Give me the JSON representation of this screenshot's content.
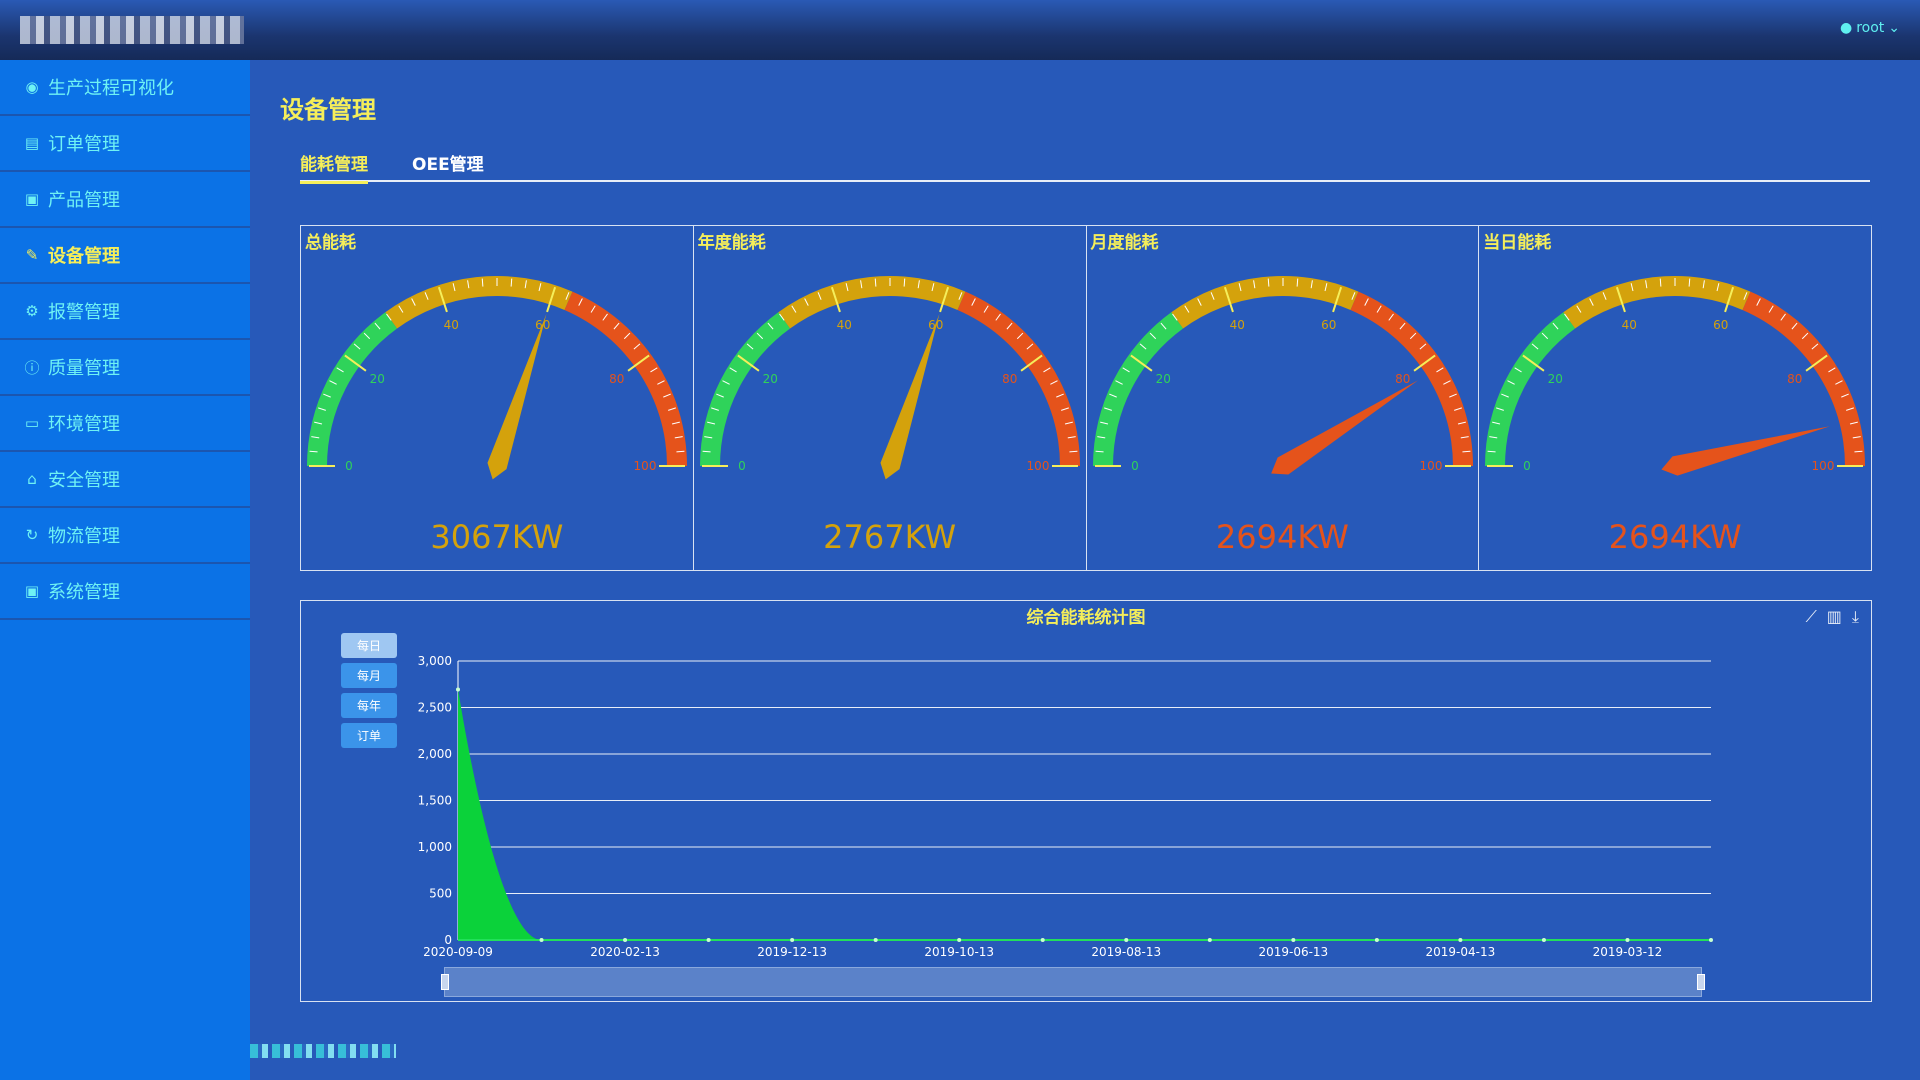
{
  "user": {
    "name": "root"
  },
  "sidebar": {
    "items": [
      {
        "label": "生产过程可视化",
        "icon": "eye-icon",
        "glyph": "◉"
      },
      {
        "label": "订单管理",
        "icon": "document-icon",
        "glyph": "▤"
      },
      {
        "label": "产品管理",
        "icon": "product-icon",
        "glyph": "▣"
      },
      {
        "label": "设备管理",
        "icon": "pen-icon",
        "glyph": "✎"
      },
      {
        "label": "报警管理",
        "icon": "chip-icon",
        "glyph": "⚙"
      },
      {
        "label": "质量管理",
        "icon": "info-icon",
        "glyph": "ⓘ"
      },
      {
        "label": "环境管理",
        "icon": "box-icon",
        "glyph": "▭"
      },
      {
        "label": "安全管理",
        "icon": "shield-icon",
        "glyph": "⌂"
      },
      {
        "label": "物流管理",
        "icon": "refresh-icon",
        "glyph": "↻"
      },
      {
        "label": "系统管理",
        "icon": "settings-icon",
        "glyph": "▣"
      }
    ],
    "active_index": 3
  },
  "page": {
    "title": "设备管理"
  },
  "tabs": [
    {
      "label": "能耗管理",
      "active": true
    },
    {
      "label": "OEE管理",
      "active": false
    }
  ],
  "gauges": [
    {
      "title": "总能耗",
      "value": 3067,
      "display": "3067KW",
      "needle_percent": 60,
      "color": "#d4a20c"
    },
    {
      "title": "年度能耗",
      "value": 2767,
      "display": "2767KW",
      "needle_percent": 60,
      "color": "#d4a20c"
    },
    {
      "title": "月度能耗",
      "value": 2694,
      "display": "2694KW",
      "needle_percent": 82,
      "color": "#e5531b"
    },
    {
      "title": "当日能耗",
      "value": 2694,
      "display": "2694KW",
      "needle_percent": 92,
      "color": "#e5531b"
    }
  ],
  "gauge_scale": {
    "min": 0,
    "max": 100,
    "labels": [
      "0",
      "20",
      "40",
      "60",
      "80",
      "100"
    ]
  },
  "colors": {
    "green": "#2fd35a",
    "yellow": "#d4a20c",
    "red": "#e5531b",
    "accent": "#f5ee5a"
  },
  "chart": {
    "title": "综合能耗统计图",
    "toolbox": [
      "line-chart-icon",
      "bar-chart-icon",
      "download-icon"
    ],
    "period_buttons": [
      {
        "label": "每日",
        "active": true
      },
      {
        "label": "每月",
        "active": false
      },
      {
        "label": "每年",
        "active": false
      },
      {
        "label": "订单",
        "active": false
      }
    ]
  },
  "chart_data": {
    "type": "area",
    "title": "综合能耗统计图",
    "x_tick_labels": [
      "2020-09-09",
      "2020-02-13",
      "2019-12-13",
      "2019-10-13",
      "2019-08-13",
      "2019-06-13",
      "2019-04-13",
      "2019-03-12"
    ],
    "y_tick_labels": [
      "0",
      "500",
      "1,000",
      "1,500",
      "2,000",
      "2,500",
      "3,000"
    ],
    "ylim": [
      0,
      3000
    ],
    "grid": true,
    "series": [
      {
        "values": [
          2694,
          0,
          0,
          0,
          0,
          0,
          0,
          0,
          0,
          0,
          0,
          0,
          0,
          0,
          0,
          0
        ],
        "color": "#0bd23a"
      }
    ]
  }
}
